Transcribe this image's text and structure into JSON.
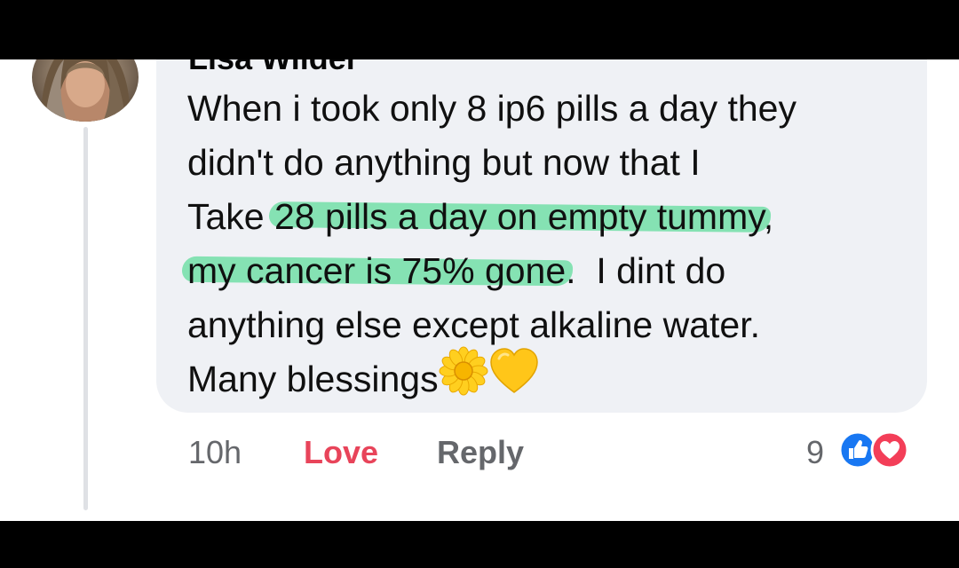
{
  "comment": {
    "author_partial": "Lisa Wilder",
    "lines": [
      [
        {
          "t": "When i took only 8 ip6 pills a day they",
          "h": false
        }
      ],
      [
        {
          "t": "didn't do anything but now that I",
          "h": false
        }
      ],
      [
        {
          "t": "Take ",
          "h": false
        },
        {
          "t": "28 pills a day on empty tummy",
          "h": true
        },
        {
          "t": ",",
          "h": false
        }
      ],
      [
        {
          "t": "my cancer is 75% gone",
          "h": true
        },
        {
          "t": ".  I dint do",
          "h": false
        }
      ],
      [
        {
          "t": "anything else except alkaline water.",
          "h": false
        }
      ],
      [
        {
          "t": "Many blessings",
          "h": false
        }
      ]
    ],
    "emojis": [
      "sunflower-emoji",
      "yellow-heart-emoji"
    ],
    "highlight_color": "#66dea0"
  },
  "actions": {
    "time": "10h",
    "love_label": "Love",
    "reply_label": "Reply"
  },
  "reactions": {
    "count": "9",
    "icons": [
      "like-icon",
      "love-icon"
    ],
    "like_color": "#1877f2",
    "love_color": "#f33e58"
  },
  "colors": {
    "bubble": "#eff1f5",
    "love_action": "#e8445a",
    "muted": "#65676b"
  }
}
